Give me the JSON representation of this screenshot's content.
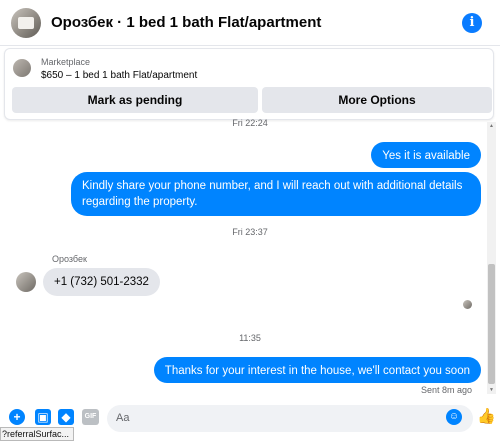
{
  "header": {
    "title": "Орозбек · 1 bed 1 bath Flat/apartment",
    "info_icon": "i"
  },
  "listing": {
    "source": "Marketplace",
    "name": "$650 – 1 bed 1 bath Flat/apartment",
    "pending_label": "Mark as pending",
    "more_label": "More Options"
  },
  "messages": {
    "ts1": "Fri 22:24",
    "out1": "Yes it is available",
    "out2": "Kindly share your phone number, and I will reach out with additional details regarding the property.",
    "ts2": "Fri 23:37",
    "sender": "Орозбек",
    "in1": "+1 (732) 501-2332",
    "ts3": "11:35",
    "out3": "Thanks for your interest in the house, we'll contact you soon",
    "sent_status": "Sent 8m ago"
  },
  "composer": {
    "placeholder": "Aa",
    "gif": "GIF"
  },
  "status_tip": "?referralSurfac..."
}
